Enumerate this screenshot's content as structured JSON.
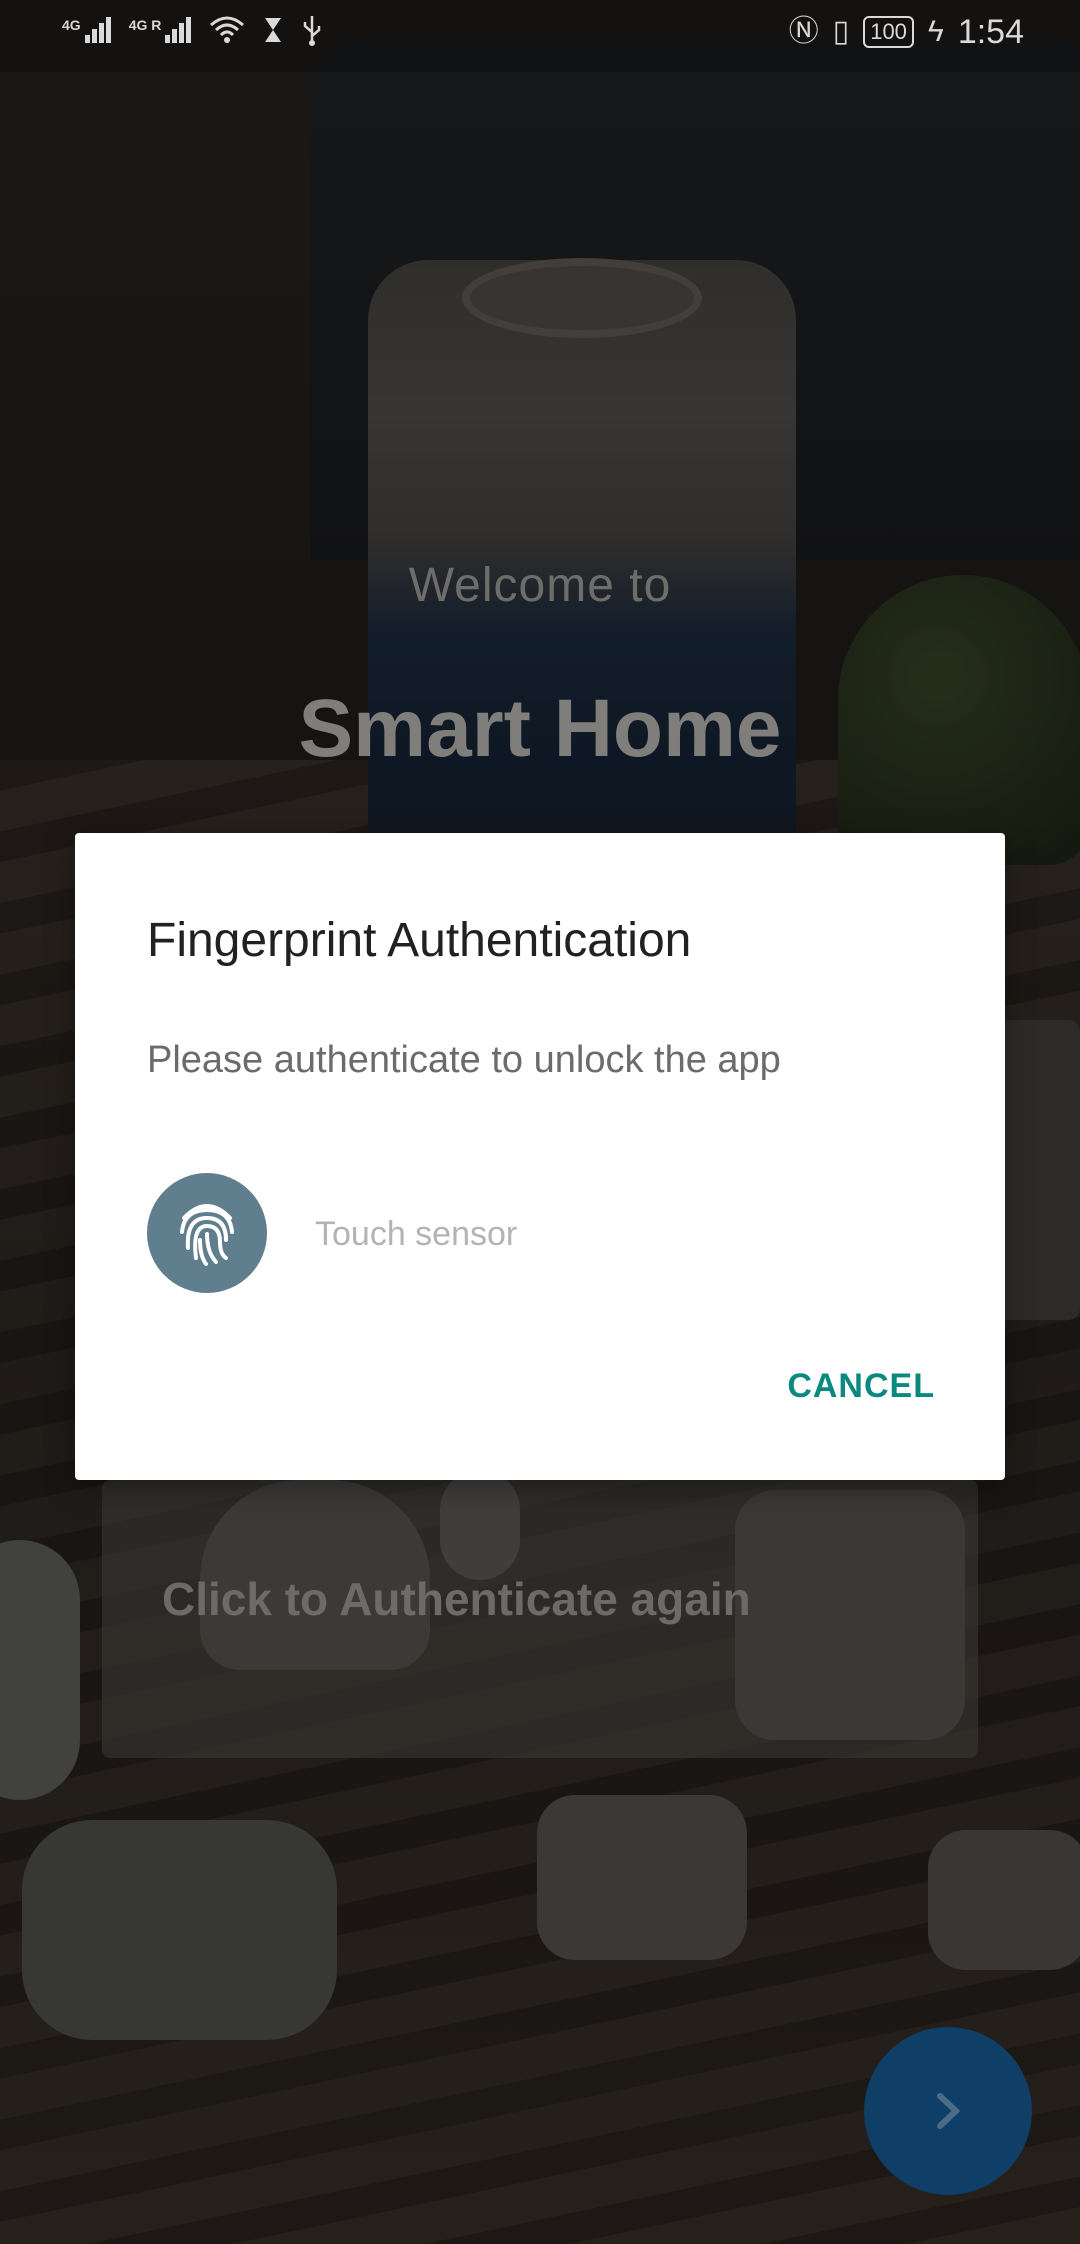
{
  "status_bar": {
    "net1": "4G",
    "net2": "4G R",
    "battery": "100",
    "time": "1:54"
  },
  "welcome": {
    "subtitle": "Welcome to",
    "app_name": "Smart Home"
  },
  "auth_again": {
    "label": "Click to Authenticate again"
  },
  "dialog": {
    "title": "Fingerprint Authentication",
    "message": "Please authenticate to unlock the app",
    "sensor_status": "Touch sensor",
    "cancel_label": "CANCEL"
  },
  "colors": {
    "accent": "#0a8a7e",
    "fingerprint_bg": "#5f7f8f",
    "fab": "#0f3e66"
  },
  "icons": {
    "fingerprint": "fingerprint-icon",
    "next": "chevron-right-icon"
  }
}
